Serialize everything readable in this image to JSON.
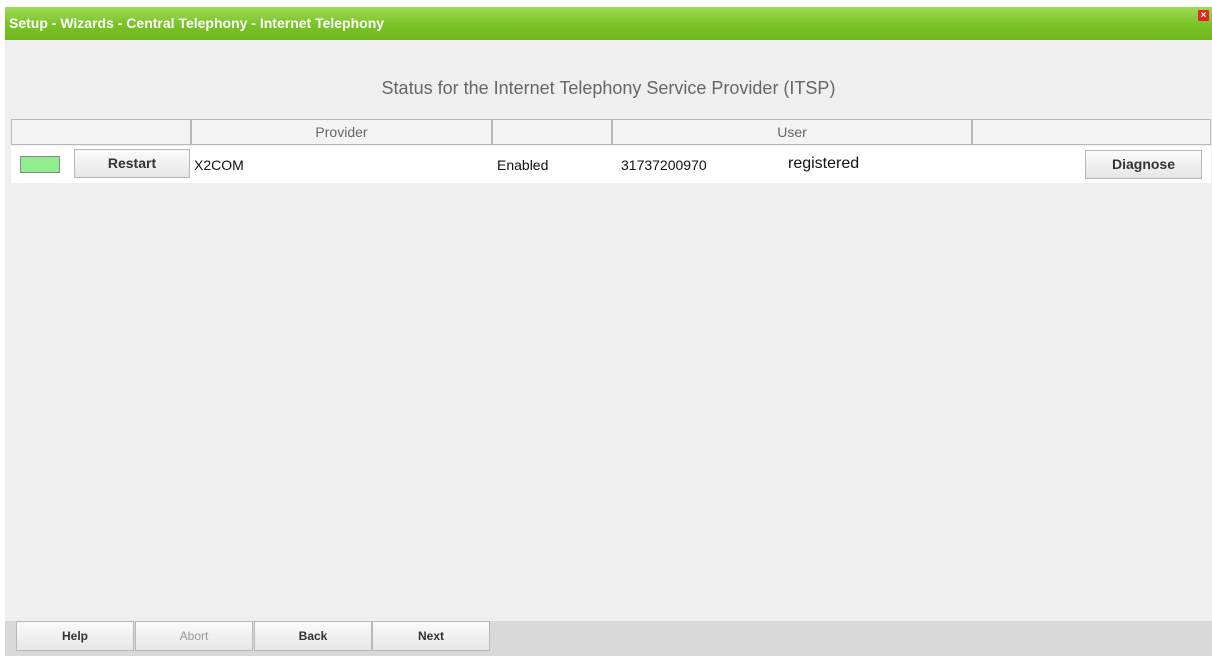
{
  "window": {
    "title": "Setup - Wizards - Central Telephony - Internet Telephony",
    "close_glyph": "×"
  },
  "heading": "Status for the Internet Telephony Service Provider (ITSP)",
  "table": {
    "headers": [
      "",
      "Provider",
      "",
      "User",
      ""
    ],
    "rows": [
      {
        "status_color": "#90ee90",
        "restart_label": "Restart",
        "provider": "X2COM",
        "state": "Enabled",
        "user": "31737200970",
        "registration": "registered",
        "diagnose_label": "Diagnose"
      }
    ]
  },
  "footer": {
    "help": "Help",
    "abort": "Abort",
    "back": "Back",
    "next": "Next"
  }
}
